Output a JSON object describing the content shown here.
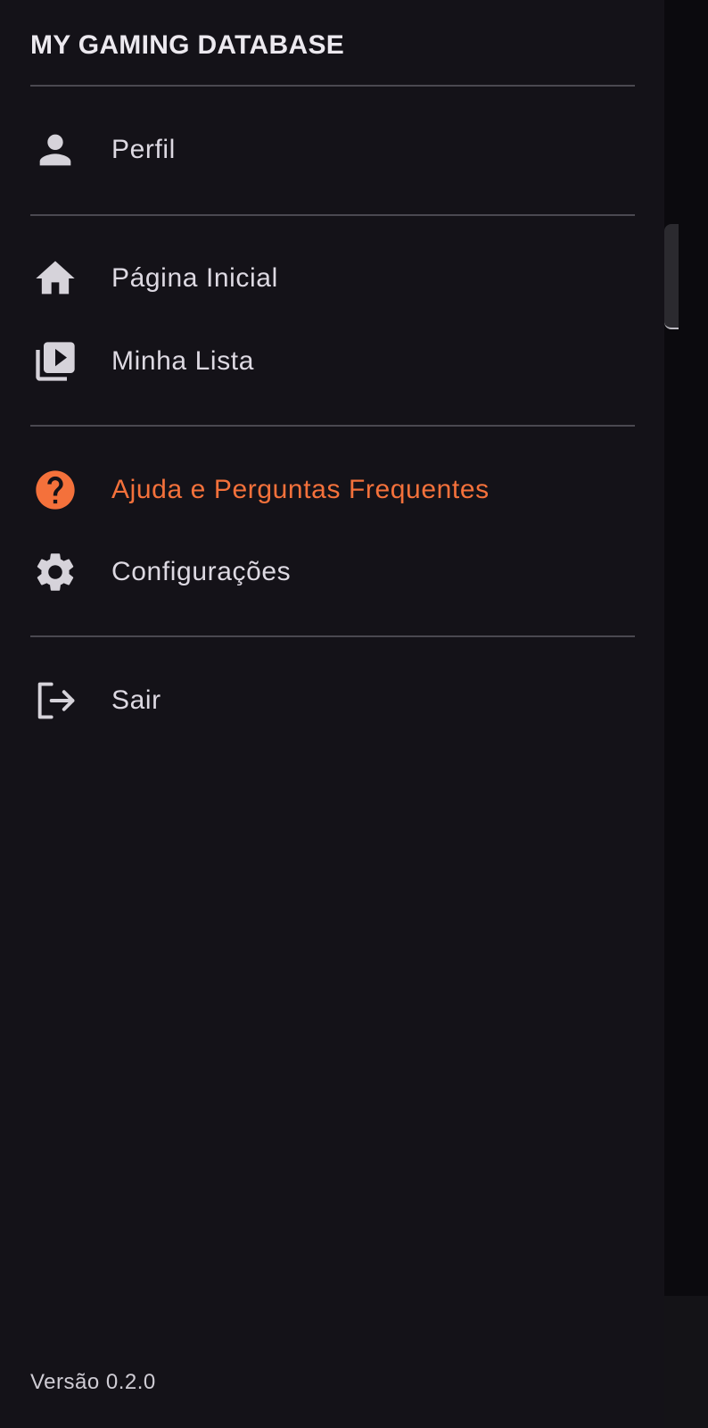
{
  "drawer": {
    "title": "MY GAMING DATABASE",
    "items": [
      {
        "label": "Perfil",
        "icon": "person-icon"
      },
      {
        "label": "Página Inicial",
        "icon": "home-icon"
      },
      {
        "label": "Minha Lista",
        "icon": "video-library-icon"
      },
      {
        "label": "Ajuda e Perguntas Frequentes",
        "icon": "help-icon",
        "active": true
      },
      {
        "label": "Configurações",
        "icon": "gear-icon"
      },
      {
        "label": "Sair",
        "icon": "logout-icon"
      }
    ],
    "version": "Versão 0.2.0"
  },
  "colors": {
    "accent": "#f4713b",
    "drawer_background": "#141218",
    "text": "#ddd9e2",
    "icon": "#d6d3da",
    "divider": "#4a4850"
  }
}
